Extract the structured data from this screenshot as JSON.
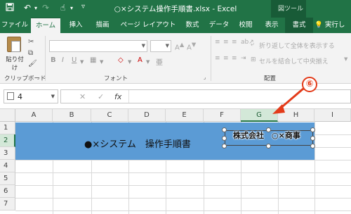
{
  "titlebar": {
    "filename": "○×システム操作手順書.xlsx - Excel",
    "context_group": "図ツール",
    "save_icon": "save-icon",
    "undo_icon": "undo-icon",
    "redo_icon": "redo-icon",
    "touch_icon": "touch-mode-icon"
  },
  "tabs": [
    {
      "label": "ファイル"
    },
    {
      "label": "ホーム"
    },
    {
      "label": "挿入"
    },
    {
      "label": "描画"
    },
    {
      "label": "ページ レイアウト"
    },
    {
      "label": "数式"
    },
    {
      "label": "データ"
    },
    {
      "label": "校閲"
    },
    {
      "label": "表示"
    },
    {
      "label": "書式"
    }
  ],
  "tell_me": "実行した",
  "ribbon": {
    "paste_label": "貼り付け",
    "groups": {
      "clipboard": "クリップボード",
      "font": "フォント",
      "alignment": "配置"
    },
    "wrap_text": "折り返して全体を表示する",
    "merge_center": "セルを結合して中央揃え"
  },
  "formula_bar": {
    "name_box": "4",
    "cancel_icon": "✕",
    "enter_icon": "✓",
    "fx_label": "fx",
    "value": ""
  },
  "grid": {
    "columns": [
      "A",
      "B",
      "C",
      "D",
      "E",
      "F",
      "G",
      "H",
      "I"
    ],
    "rows": [
      "1",
      "2",
      "3",
      "4",
      "5",
      "6",
      "7"
    ],
    "selected_column": "G",
    "selected_row": "2",
    "band_color": "#5b9bd5"
  },
  "sheet": {
    "title": "●×システム　操作手順書",
    "company": "株式会社　○×商事"
  },
  "callout": {
    "number": "⑥",
    "color": "#e33b1a"
  }
}
